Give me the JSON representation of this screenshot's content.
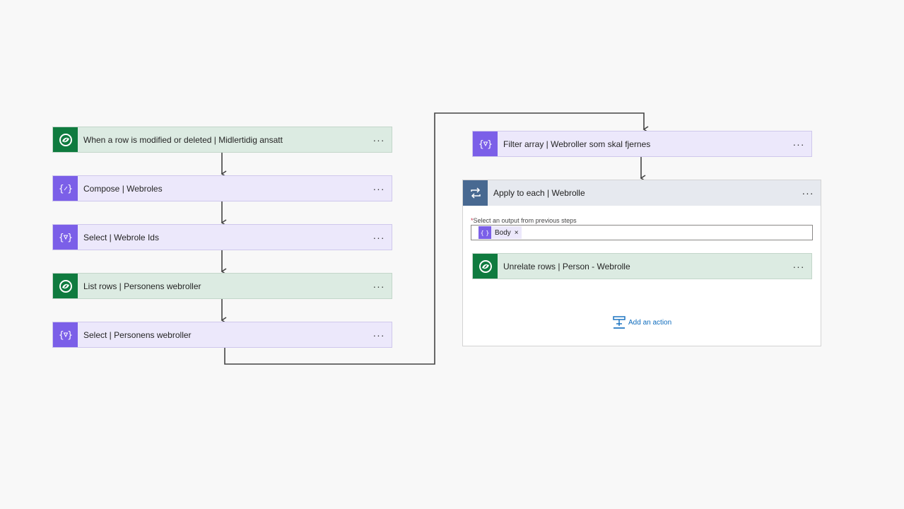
{
  "left_column": [
    {
      "label": "When a row is modified or deleted | Midlertidig ansatt",
      "kind": "dataverse",
      "icon": "dataverse-icon"
    },
    {
      "label": "Compose | Webroles",
      "kind": "data-operation",
      "icon": "compose-icon"
    },
    {
      "label": "Select | Webrole Ids",
      "kind": "data-operation",
      "icon": "select-icon"
    },
    {
      "label": "List rows | Personens webroller",
      "kind": "dataverse",
      "icon": "dataverse-icon"
    },
    {
      "label": "Select | Personens webroller",
      "kind": "data-operation",
      "icon": "select-icon"
    }
  ],
  "filter_step": {
    "label": "Filter array | Webroller som skal fjernes",
    "icon": "filter-icon"
  },
  "apply_to_each": {
    "label": "Apply to each | Webrolle",
    "icon": "loop-icon",
    "required_marker": "*",
    "field_label": "Select an output from previous steps",
    "token_label": "Body",
    "token_remove": "×",
    "inner_step": {
      "label": "Unrelate rows | Person - Webrolle",
      "icon": "dataverse-icon"
    },
    "add_action_label": "Add an action"
  },
  "more_label": "···",
  "colors": {
    "dataverse": "#0f7b3f",
    "data_operation": "#7b5fe8",
    "loop": "#486991",
    "link": "#0f6cbd"
  }
}
